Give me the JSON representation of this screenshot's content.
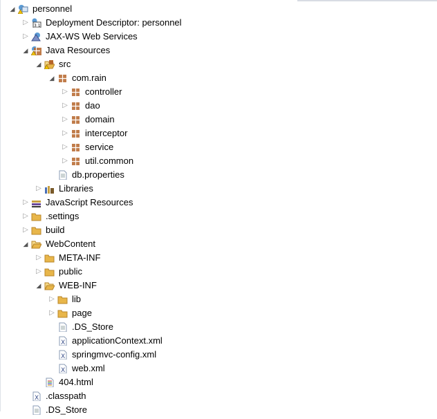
{
  "colors": {
    "folder": "#e8b64a",
    "package": "#b5652a",
    "package_plain": "#8a6a3a",
    "xml": "#3a4f8a",
    "warning": "#f2c200"
  },
  "tree": [
    {
      "label": "personnel",
      "level": 0,
      "state": "expanded",
      "icon": "project-icon"
    },
    {
      "label": "Deployment Descriptor: personnel",
      "level": 1,
      "state": "collapsed",
      "icon": "deployment-descriptor-icon"
    },
    {
      "label": "JAX-WS Web Services",
      "level": 1,
      "state": "collapsed",
      "icon": "web-services-icon"
    },
    {
      "label": "Java Resources",
      "level": 1,
      "state": "expanded",
      "icon": "java-resources-icon"
    },
    {
      "label": "src",
      "level": 2,
      "state": "expanded",
      "icon": "source-folder-icon"
    },
    {
      "label": "com.rain",
      "level": 3,
      "state": "expanded",
      "icon": "package-icon"
    },
    {
      "label": "controller",
      "level": 4,
      "state": "collapsed",
      "icon": "package-icon"
    },
    {
      "label": "dao",
      "level": 4,
      "state": "collapsed",
      "icon": "package-icon"
    },
    {
      "label": "domain",
      "level": 4,
      "state": "collapsed",
      "icon": "package-icon"
    },
    {
      "label": "interceptor",
      "level": 4,
      "state": "collapsed",
      "icon": "package-icon"
    },
    {
      "label": "service",
      "level": 4,
      "state": "collapsed",
      "icon": "package-icon"
    },
    {
      "label": "util.common",
      "level": 4,
      "state": "collapsed",
      "icon": "package-icon"
    },
    {
      "label": "db.properties",
      "level": 3,
      "state": "leaf",
      "icon": "file-icon"
    },
    {
      "label": "Libraries",
      "level": 2,
      "state": "collapsed",
      "icon": "libraries-icon"
    },
    {
      "label": "JavaScript Resources",
      "level": 1,
      "state": "collapsed",
      "icon": "javascript-resources-icon"
    },
    {
      "label": ".settings",
      "level": 1,
      "state": "collapsed",
      "icon": "folder-icon"
    },
    {
      "label": "build",
      "level": 1,
      "state": "collapsed",
      "icon": "folder-icon"
    },
    {
      "label": "WebContent",
      "level": 1,
      "state": "expanded",
      "icon": "folder-open-icon"
    },
    {
      "label": "META-INF",
      "level": 2,
      "state": "collapsed",
      "icon": "folder-icon"
    },
    {
      "label": "public",
      "level": 2,
      "state": "collapsed",
      "icon": "folder-icon"
    },
    {
      "label": "WEB-INF",
      "level": 2,
      "state": "expanded",
      "icon": "folder-open-icon"
    },
    {
      "label": "lib",
      "level": 3,
      "state": "collapsed",
      "icon": "folder-icon"
    },
    {
      "label": "page",
      "level": 3,
      "state": "collapsed",
      "icon": "folder-icon"
    },
    {
      "label": ".DS_Store",
      "level": 3,
      "state": "leaf",
      "icon": "file-icon"
    },
    {
      "label": "applicationContext.xml",
      "level": 3,
      "state": "leaf",
      "icon": "xml-file-icon"
    },
    {
      "label": "springmvc-config.xml",
      "level": 3,
      "state": "leaf",
      "icon": "xml-file-icon"
    },
    {
      "label": "web.xml",
      "level": 3,
      "state": "leaf",
      "icon": "xml-file-icon"
    },
    {
      "label": "404.html",
      "level": 2,
      "state": "leaf",
      "icon": "html-file-icon"
    },
    {
      "label": ".classpath",
      "level": 1,
      "state": "leaf",
      "icon": "xml-file-icon"
    },
    {
      "label": ".DS_Store",
      "level": 1,
      "state": "leaf",
      "icon": "file-icon"
    }
  ]
}
